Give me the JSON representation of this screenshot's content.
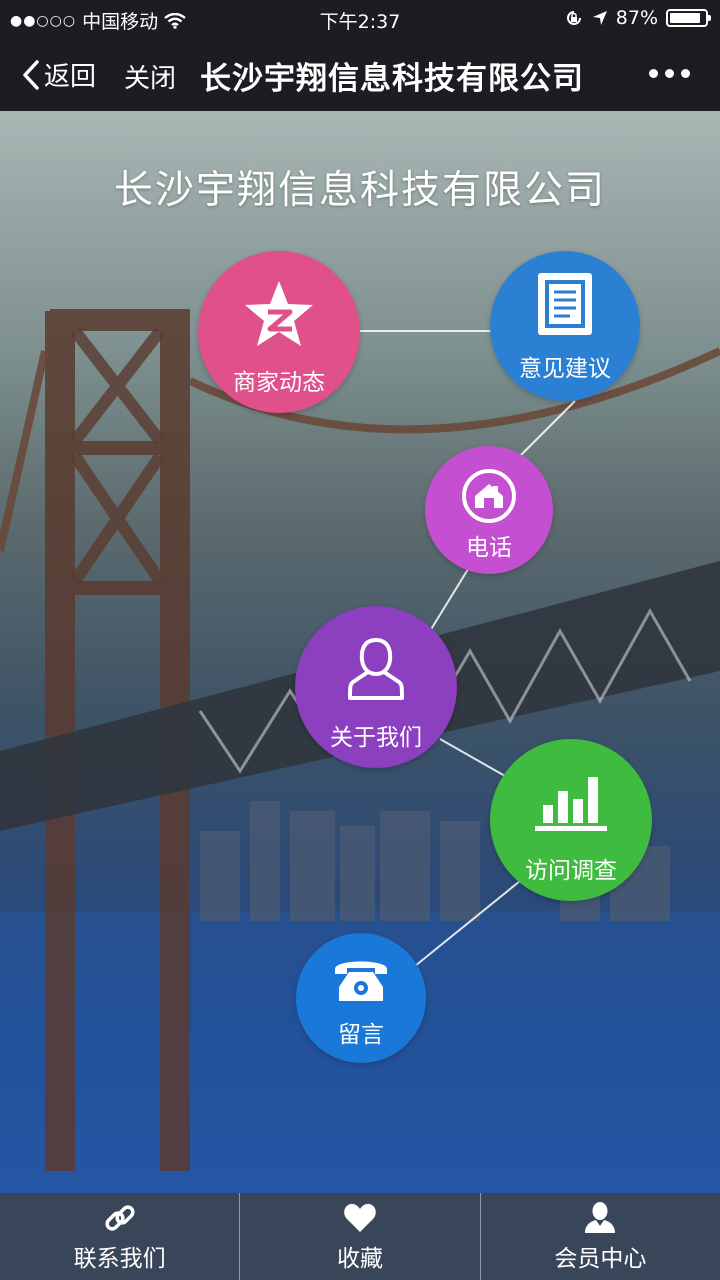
{
  "status_bar": {
    "signal_dots": "●●○○○",
    "carrier": "中国移动",
    "time": "下午2:37",
    "battery_percent": "87%",
    "battery_level": 0.87
  },
  "nav": {
    "back_label": "返回",
    "close_label": "关闭",
    "title": "长沙宇翔信息科技有限公司"
  },
  "main": {
    "title": "长沙宇翔信息科技有限公司",
    "items": [
      {
        "label": "商家动态",
        "icon": "qzone-star-icon",
        "color": "#e0508a"
      },
      {
        "label": "意见建议",
        "icon": "document-icon",
        "color": "#2c80d4"
      },
      {
        "label": "电话",
        "icon": "house-icon",
        "color": "#c44fd0"
      },
      {
        "label": "关于我们",
        "icon": "person-icon",
        "color": "#8c3fbe"
      },
      {
        "label": "访问调查",
        "icon": "bar-chart-icon",
        "color": "#3fbb3f"
      },
      {
        "label": "留言",
        "icon": "telephone-icon",
        "color": "#1a78d8"
      }
    ]
  },
  "tabbar": {
    "tabs": [
      {
        "label": "联系我们",
        "icon": "link-icon"
      },
      {
        "label": "收藏",
        "icon": "heart-icon"
      },
      {
        "label": "会员中心",
        "icon": "user-icon"
      }
    ]
  }
}
